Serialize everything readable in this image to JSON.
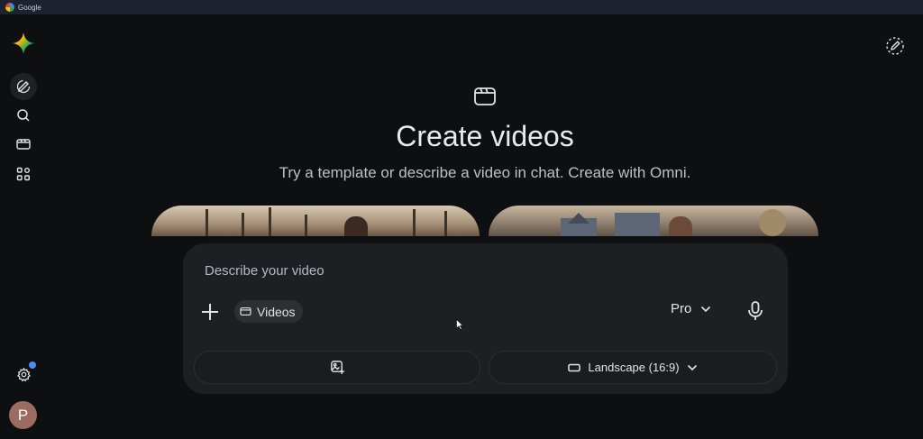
{
  "window": {
    "title": "Google"
  },
  "sidebar": {
    "items": [
      {
        "name": "new-chat",
        "icon": "edit-icon"
      },
      {
        "name": "search",
        "icon": "search-icon"
      },
      {
        "name": "videos",
        "icon": "video-icon"
      },
      {
        "name": "apps",
        "icon": "apps-grid-icon"
      }
    ],
    "settings_icon": "gear-icon",
    "avatar_initial": "P"
  },
  "header": {
    "new_chat_icon": "edit-dashed-icon"
  },
  "hero": {
    "icon": "clapperboard-icon",
    "title": "Create videos",
    "subtitle": "Try a template or describe a video in chat. Create with Omni."
  },
  "composer": {
    "placeholder": "Describe your video",
    "chip_label": "Videos",
    "mode_label": "Pro",
    "add_image_icon": "add-image-icon",
    "aspect_label": "Landscape (16:9)"
  },
  "colors": {
    "background": "#0e0f11",
    "composer": "#1e1f22",
    "accent_dot": "#4b8cf5"
  }
}
